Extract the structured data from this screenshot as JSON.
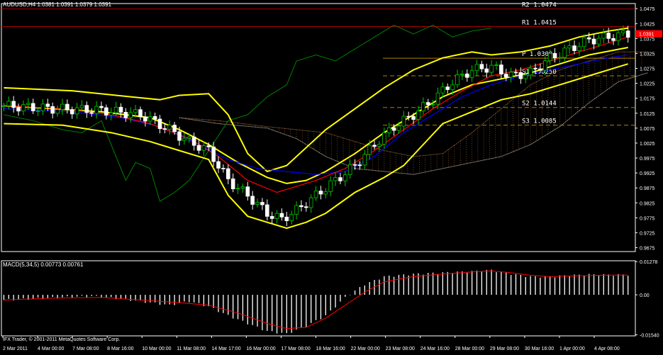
{
  "window": {
    "title": "AUDUSD,H4",
    "ohlc": "1.0381 1.0391 1.0379 1.0391",
    "indicator_label": "MACD(5,34,5)",
    "indicator_values": "0.00773 0.00761",
    "copyright": "IFX Trader, © 2001-2011 MetaQuotes Software Corp."
  },
  "colors": {
    "background": "#000000",
    "axis": "#ffffff",
    "bull_candle": "#00c800",
    "bear_candle": "#ffffff",
    "bollinger": "#ffff00",
    "ma_red": "#ff0000",
    "ma_blue": "#0000ff",
    "chikou": "#008000",
    "kumo": "#b0703c",
    "pivot_line": "#b08000",
    "resistance_line": "#aa0000",
    "macd_hist": "#ffffff",
    "macd_signal": "#ff0000",
    "current_price_tag": "#ff0000"
  },
  "chart_data": [
    {
      "type": "candlestick",
      "title": "AUDUSD,H4",
      "y_ticks": [
        "1.0475",
        "1.0425",
        "1.0375",
        "1.0325",
        "1.0275",
        "1.0225",
        "1.0175",
        "1.0125",
        "1.0075",
        "1.0025",
        "0.9975",
        "0.9925",
        "0.9875",
        "0.9825",
        "0.9775",
        "0.9725",
        "0.9675"
      ],
      "current_price": "1.0391",
      "ylim": [
        0.9662,
        1.0492
      ],
      "x_ticks": [
        "2 Mar 2011",
        "4 Mar 00:00",
        "7 Mar 08:00",
        "8 Mar 16:00",
        "10 Mar 00:00",
        "11 Mar 08:00",
        "14 Mar 17:00",
        "16 Mar 00:00",
        "17 Mar 08:00",
        "18 Mar 16:00",
        "22 Mar 00:00",
        "23 Mar 08:00",
        "24 Mar 16:00",
        "28 Mar 00:00",
        "29 Mar 08:00",
        "30 Mar 16:00",
        "1 Apr 00:00",
        "4 Apr 08:00"
      ],
      "pivot_levels": [
        {
          "label": "R2",
          "value": "1.0474"
        },
        {
          "label": "R1",
          "value": "1.0415"
        },
        {
          "label": "P",
          "value": "1.0309"
        },
        {
          "label": "S1",
          "value": "1.0250"
        },
        {
          "label": "S2",
          "value": "1.0144"
        },
        {
          "label": "S3",
          "value": "1.0085"
        }
      ],
      "close_path": [
        [
          0,
          1.015
        ],
        [
          10,
          1.014
        ],
        [
          20,
          1.0135
        ],
        [
          28,
          1.012
        ],
        [
          34,
          1.007
        ],
        [
          38,
          1.003
        ],
        [
          42,
          1.0
        ],
        [
          46,
          0.99
        ],
        [
          50,
          0.985
        ],
        [
          54,
          0.979
        ],
        [
          57,
          0.977
        ],
        [
          60,
          0.98
        ],
        [
          64,
          0.985
        ],
        [
          68,
          0.99
        ],
        [
          72,
          0.995
        ],
        [
          76,
          1.002
        ],
        [
          80,
          1.008
        ],
        [
          84,
          1.012
        ],
        [
          88,
          1.017
        ],
        [
          92,
          1.023
        ],
        [
          96,
          1.027
        ],
        [
          100,
          1.028
        ],
        [
          104,
          1.025
        ],
        [
          108,
          1.026
        ],
        [
          112,
          1.031
        ],
        [
          116,
          1.034
        ],
        [
          120,
          1.037
        ],
        [
          124,
          1.038
        ],
        [
          128,
          1.0391
        ]
      ],
      "bollinger_upper": [
        [
          0,
          1.021
        ],
        [
          14,
          1.02
        ],
        [
          26,
          1.018
        ],
        [
          32,
          1.017
        ],
        [
          36,
          1.0185
        ],
        [
          42,
          1.019
        ],
        [
          46,
          1.012
        ],
        [
          50,
          0.999
        ],
        [
          54,
          0.993
        ],
        [
          58,
          0.995
        ],
        [
          62,
          1.001
        ],
        [
          66,
          1.007
        ],
        [
          72,
          1.014
        ],
        [
          78,
          1.021
        ],
        [
          84,
          1.027
        ],
        [
          90,
          1.031
        ],
        [
          96,
          1.033
        ],
        [
          100,
          1.032
        ],
        [
          106,
          1.033
        ],
        [
          112,
          1.035
        ],
        [
          118,
          1.038
        ],
        [
          124,
          1.04
        ],
        [
          128,
          1.041
        ]
      ],
      "bollinger_middle": [
        [
          0,
          1.015
        ],
        [
          10,
          1.014
        ],
        [
          20,
          1.013
        ],
        [
          30,
          1.011
        ],
        [
          36,
          1.007
        ],
        [
          42,
          1.002
        ],
        [
          48,
          0.996
        ],
        [
          54,
          0.991
        ],
        [
          58,
          0.989
        ],
        [
          62,
          0.99
        ],
        [
          66,
          0.993
        ],
        [
          72,
          0.999
        ],
        [
          78,
          1.006
        ],
        [
          84,
          1.012
        ],
        [
          90,
          1.018
        ],
        [
          96,
          1.022
        ],
        [
          102,
          1.024
        ],
        [
          108,
          1.026
        ],
        [
          114,
          1.029
        ],
        [
          120,
          1.032
        ],
        [
          128,
          1.0345
        ]
      ],
      "bollinger_lower": [
        [
          0,
          1.009
        ],
        [
          12,
          1.0085
        ],
        [
          22,
          1.006
        ],
        [
          30,
          1.003
        ],
        [
          36,
          1.0
        ],
        [
          42,
          0.997
        ],
        [
          46,
          0.985
        ],
        [
          50,
          0.978
        ],
        [
          54,
          0.976
        ],
        [
          58,
          0.974
        ],
        [
          62,
          0.976
        ],
        [
          66,
          0.979
        ],
        [
          72,
          0.986
        ],
        [
          78,
          0.991
        ],
        [
          82,
          0.995
        ],
        [
          86,
          1.002
        ],
        [
          90,
          1.009
        ],
        [
          96,
          1.013
        ],
        [
          102,
          1.017
        ],
        [
          108,
          1.019
        ],
        [
          114,
          1.022
        ],
        [
          120,
          1.025
        ],
        [
          128,
          1.029
        ]
      ],
      "ma_red": [
        [
          0,
          1.015
        ],
        [
          12,
          1.014
        ],
        [
          22,
          1.012
        ],
        [
          30,
          1.009
        ],
        [
          38,
          1.004
        ],
        [
          44,
          0.998
        ],
        [
          50,
          0.99
        ],
        [
          56,
          0.986
        ],
        [
          60,
          0.988
        ],
        [
          64,
          0.99
        ],
        [
          70,
          0.994
        ],
        [
          76,
          1.0
        ],
        [
          82,
          1.007
        ],
        [
          88,
          1.014
        ],
        [
          94,
          1.02
        ],
        [
          100,
          1.025
        ],
        [
          106,
          1.027
        ],
        [
          112,
          1.03
        ],
        [
          118,
          1.033
        ],
        [
          124,
          1.036
        ],
        [
          128,
          1.038
        ]
      ],
      "ma_blue": [
        [
          0,
          1.014
        ],
        [
          14,
          1.013
        ],
        [
          24,
          1.011
        ],
        [
          32,
          1.008
        ],
        [
          40,
          1.002
        ],
        [
          46,
          0.997
        ],
        [
          52,
          0.994
        ],
        [
          58,
          0.993
        ],
        [
          64,
          0.992
        ],
        [
          70,
          0.993
        ],
        [
          76,
          0.998
        ],
        [
          82,
          1.006
        ],
        [
          88,
          1.012
        ],
        [
          94,
          1.018
        ],
        [
          100,
          1.022
        ],
        [
          106,
          1.025
        ],
        [
          112,
          1.027
        ],
        [
          118,
          1.029
        ],
        [
          124,
          1.031
        ],
        [
          128,
          1.032
        ]
      ],
      "chikou": [
        [
          0,
          1.012
        ],
        [
          6,
          1.01
        ],
        [
          12,
          1.007
        ],
        [
          16,
          1.006
        ],
        [
          20,
          1.01
        ],
        [
          22,
          1.002
        ],
        [
          25,
          0.99
        ],
        [
          27,
          0.996
        ],
        [
          30,
          0.994
        ],
        [
          32,
          0.983
        ],
        [
          35,
          0.986
        ],
        [
          38,
          0.99
        ],
        [
          42,
          1.0
        ],
        [
          46,
          1.01
        ],
        [
          50,
          1.012
        ],
        [
          54,
          1.018
        ],
        [
          58,
          1.022
        ],
        [
          60,
          1.03
        ],
        [
          64,
          1.032
        ],
        [
          68,
          1.03
        ],
        [
          72,
          1.034
        ],
        [
          76,
          1.038
        ],
        [
          80,
          1.042
        ],
        [
          84,
          1.039
        ],
        [
          88,
          1.042
        ],
        [
          92,
          1.038
        ],
        [
          96,
          1.04
        ],
        [
          100,
          1.041
        ]
      ],
      "kumo_upper": [
        [
          36,
          1.011
        ],
        [
          44,
          1.01
        ],
        [
          54,
          1.008
        ],
        [
          60,
          1.007
        ],
        [
          66,
          1.006
        ],
        [
          72,
          1.003
        ],
        [
          78,
          1.0
        ],
        [
          84,
          0.998
        ],
        [
          90,
          0.999
        ],
        [
          96,
          1.006
        ],
        [
          102,
          1.014
        ],
        [
          108,
          1.022
        ],
        [
          114,
          1.027
        ],
        [
          120,
          1.03
        ],
        [
          126,
          1.033
        ],
        [
          132,
          1.033
        ]
      ],
      "kumo_lower": [
        [
          36,
          1.011
        ],
        [
          44,
          1.009
        ],
        [
          54,
          1.0075
        ],
        [
          60,
          1.004
        ],
        [
          66,
          0.998
        ],
        [
          72,
          0.994
        ],
        [
          78,
          0.993
        ],
        [
          84,
          0.992
        ],
        [
          90,
          0.994
        ],
        [
          96,
          0.996
        ],
        [
          102,
          0.998
        ],
        [
          108,
          1.002
        ],
        [
          114,
          1.008
        ],
        [
          120,
          1.016
        ],
        [
          126,
          1.023
        ],
        [
          132,
          1.026
        ]
      ]
    },
    {
      "type": "bar",
      "title": "MACD(5,34,5)",
      "y_ticks": [
        "0.01278",
        "0.00",
        "-0.01540"
      ],
      "ylim": [
        -0.0158,
        0.0131
      ],
      "histogram": [
        [
          0,
          -0.002
        ],
        [
          6,
          -0.0015
        ],
        [
          12,
          -0.001
        ],
        [
          18,
          -0.0005
        ],
        [
          24,
          -0.0015
        ],
        [
          30,
          -0.003
        ],
        [
          34,
          -0.004
        ],
        [
          38,
          -0.0025
        ],
        [
          42,
          -0.0045
        ],
        [
          46,
          -0.008
        ],
        [
          50,
          -0.011
        ],
        [
          54,
          -0.014
        ],
        [
          58,
          -0.015
        ],
        [
          62,
          -0.012
        ],
        [
          66,
          -0.008
        ],
        [
          70,
          -0.001
        ],
        [
          74,
          0.004
        ],
        [
          78,
          0.007
        ],
        [
          84,
          0.008
        ],
        [
          90,
          0.0085
        ],
        [
          96,
          0.009
        ],
        [
          100,
          0.0095
        ],
        [
          104,
          0.008
        ],
        [
          108,
          0.007
        ],
        [
          112,
          0.007
        ],
        [
          116,
          0.0075
        ],
        [
          120,
          0.0078
        ],
        [
          124,
          0.0077
        ],
        [
          128,
          0.0077
        ]
      ],
      "signal": [
        [
          0,
          -0.002
        ],
        [
          10,
          -0.0013
        ],
        [
          20,
          -0.001
        ],
        [
          28,
          -0.002
        ],
        [
          36,
          -0.003
        ],
        [
          42,
          -0.004
        ],
        [
          48,
          -0.007
        ],
        [
          54,
          -0.011
        ],
        [
          58,
          -0.013
        ],
        [
          62,
          -0.0125
        ],
        [
          66,
          -0.009
        ],
        [
          70,
          -0.004
        ],
        [
          74,
          0.001
        ],
        [
          78,
          0.005
        ],
        [
          84,
          0.007
        ],
        [
          90,
          0.008
        ],
        [
          96,
          0.0088
        ],
        [
          100,
          0.0092
        ],
        [
          104,
          0.0085
        ],
        [
          108,
          0.0075
        ],
        [
          112,
          0.007
        ],
        [
          118,
          0.0073
        ],
        [
          124,
          0.0076
        ],
        [
          128,
          0.0076
        ]
      ]
    }
  ]
}
